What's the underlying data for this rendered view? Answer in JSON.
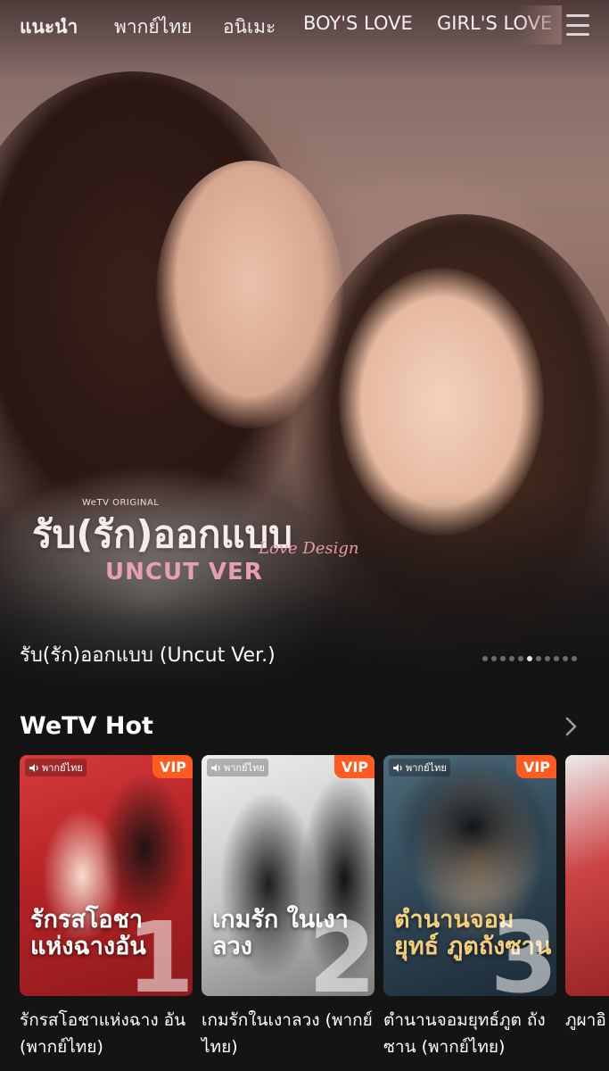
{
  "nav": {
    "items": [
      "แนะนำ",
      "พากย์ไทย",
      "อนิเมะ",
      "BOY'S LOVE",
      "GIRL'S LOVE"
    ]
  },
  "hero": {
    "logo_brand": "WeTV ORIGINAL",
    "logo_title": "รับ(รัก)ออกแบบ",
    "logo_script": "Love Design",
    "logo_version": "UNCUT VER",
    "caption": "รับ(รัก)ออกแบบ (Uncut Ver.)",
    "carousel_count": 11,
    "carousel_active_index": 5
  },
  "section": {
    "title": "WeTV Hot"
  },
  "cards": [
    {
      "dub_label": "พากย์ไทย",
      "vip": "VIP",
      "poster_text": "รักรสโอชา แห่งฉางอัน",
      "rank": "1",
      "title": "รักรสโอชาแห่งฉาง อัน (พากย์ไทย)"
    },
    {
      "dub_label": "พากย์ไทย",
      "vip": "VIP",
      "poster_text": "เกมรัก ในเงาลวง",
      "rank": "2",
      "title": "เกมรักในเงาลวง (พากย์ไทย)"
    },
    {
      "dub_label": "พากย์ไทย",
      "vip": "VIP",
      "poster_text": "ตำนานจอมยุทธ์ ภูตถังซาน",
      "rank": "3",
      "title": "ตำนานจอมยุทธ์ภูต ถังซาน (พากย์ไทย)"
    },
    {
      "title": "ภูผาอิ"
    }
  ],
  "colors": {
    "background": "#141414",
    "vip_badge": "#ff5a1f",
    "text": "#ffffff"
  }
}
